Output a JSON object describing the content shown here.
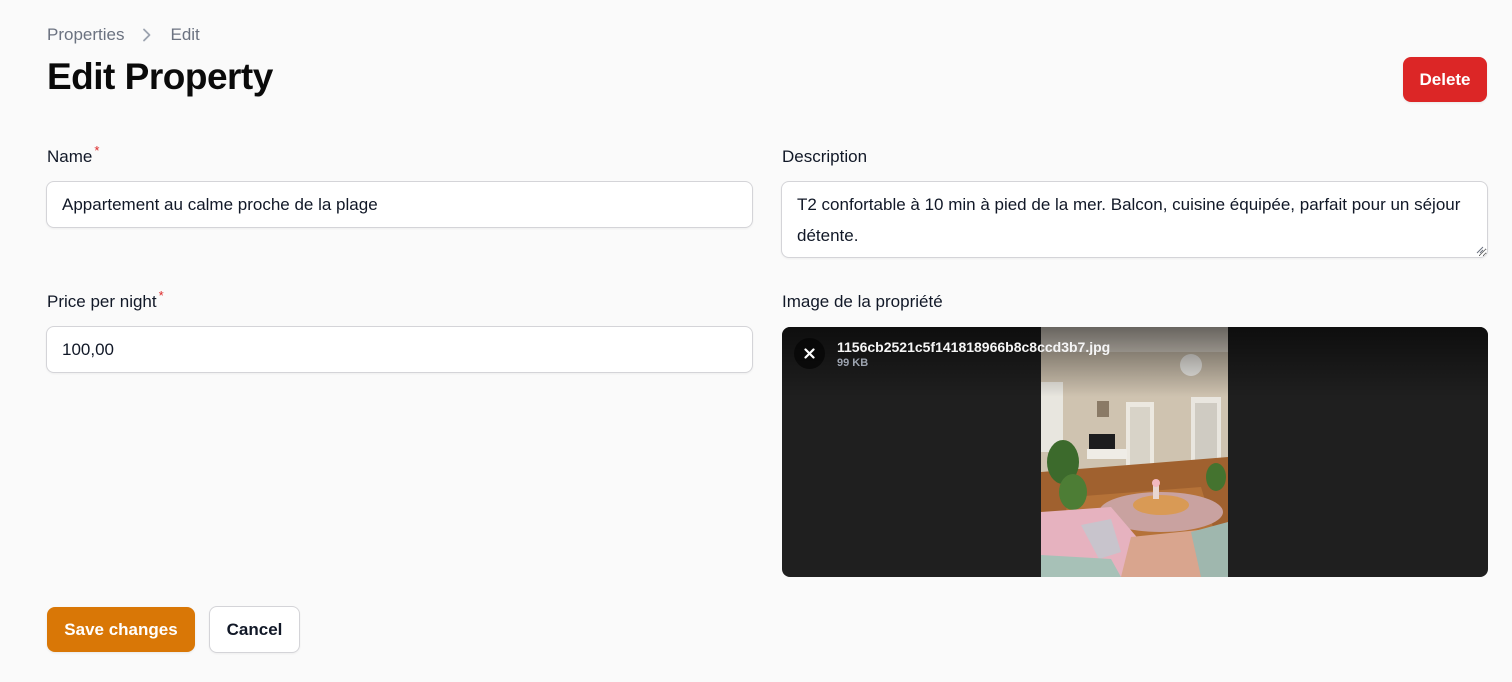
{
  "breadcrumb": {
    "items": [
      "Properties",
      "Edit"
    ]
  },
  "header": {
    "title": "Edit Property",
    "delete_label": "Delete"
  },
  "form": {
    "name": {
      "label": "Name",
      "required_mark": "*",
      "value": "Appartement au calme proche de la plage"
    },
    "description": {
      "label": "Description",
      "value": "T2 confortable à 10 min à pied de la mer. Balcon, cuisine équipée, parfait pour un séjour détente."
    },
    "price": {
      "label": "Price per night",
      "required_mark": "*",
      "value": "100,00"
    },
    "image": {
      "label": "Image de la propriété",
      "file_name": "1156cb2521c5f141818966b8c8ccd3b7.jpg",
      "file_size": "99 KB",
      "remove_icon": "close-icon"
    }
  },
  "actions": {
    "save_label": "Save changes",
    "cancel_label": "Cancel"
  },
  "colors": {
    "primary": "#d97706",
    "danger": "#dc2626",
    "required": "#dc2626"
  }
}
